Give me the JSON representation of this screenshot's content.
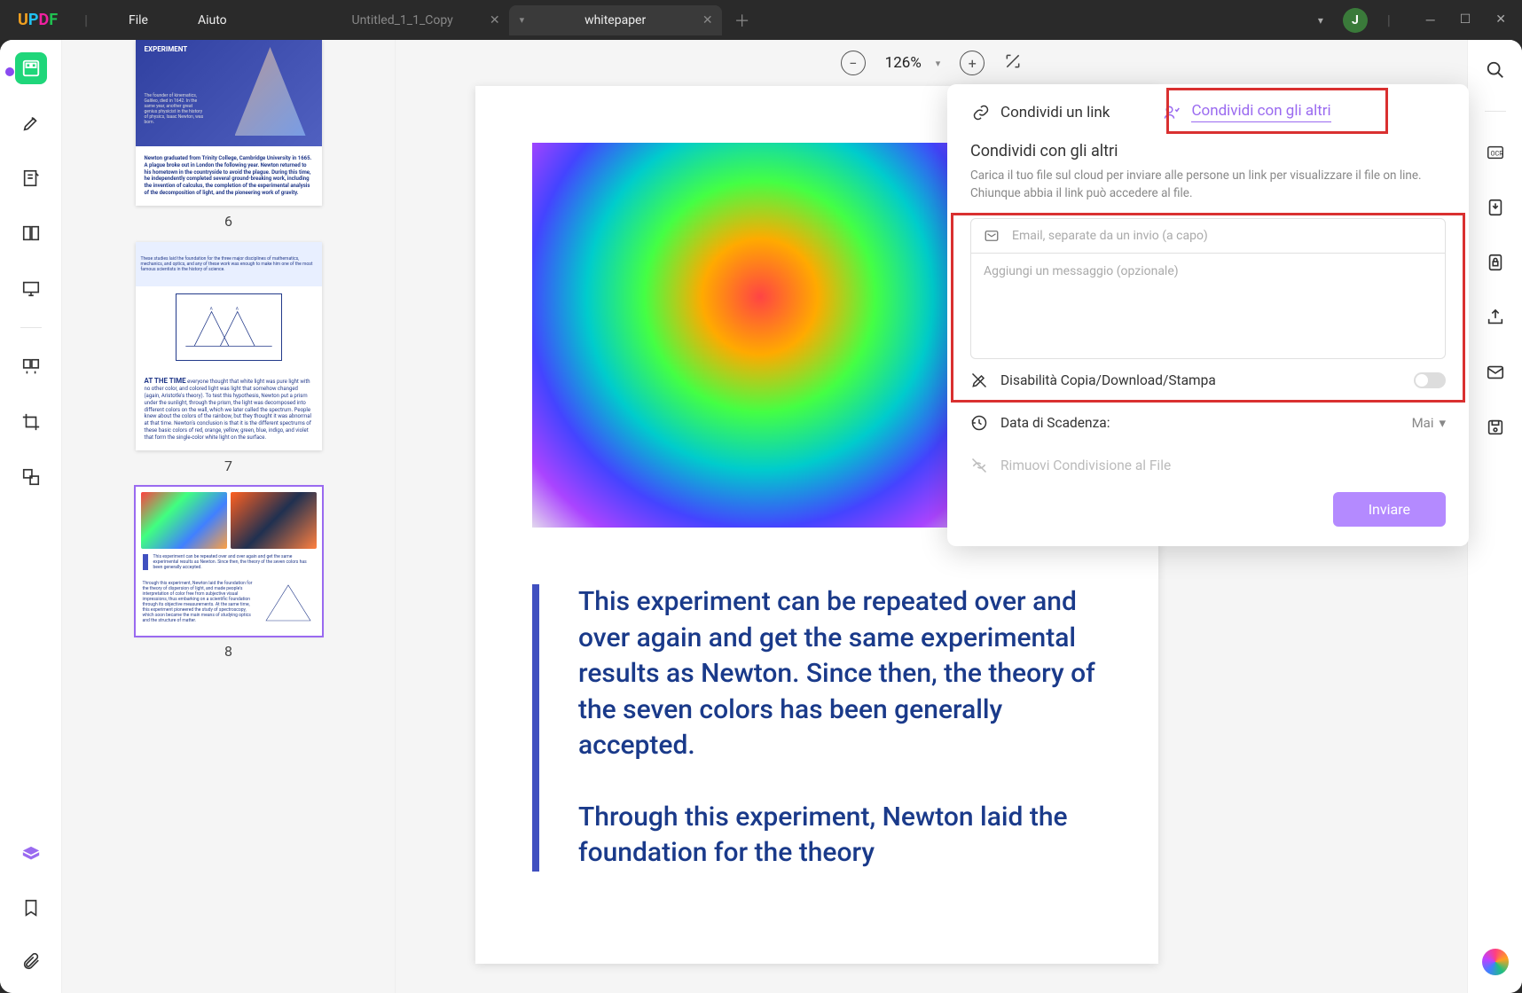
{
  "app": {
    "name": "UPDF"
  },
  "menu": {
    "file": "File",
    "help": "Aiuto"
  },
  "tabs": [
    {
      "title": "Untitled_1_1_Copy",
      "active": false
    },
    {
      "title": "whitepaper",
      "active": true
    }
  ],
  "user": {
    "initial": "J"
  },
  "zoom": {
    "value": "126%"
  },
  "thumbnails": {
    "p6": {
      "num": "6",
      "heroTitle": "EXPERIMENT",
      "body": "Newton graduated from Trinity College, Cambridge University in 1665. A plague broke out in London the following year. Newton returned to his hometown in the countryside to avoid the plague. During this time, he independently completed several ground-breaking work, including the invention of calculus, the completion of the experimental analysis of the decomposition of light, and the pioneering work of gravity."
    },
    "p7": {
      "num": "7",
      "band": "These studies laid the foundation for the three major disciplines of mathematics, mechanics, and optics, and any of these work was enough to make him one of the most famous scientists in the history of science.",
      "heading": "AT THE TIME",
      "body": "everyone thought that white light was pure light with no other color, and colored light was light that somehow changed (again, Aristotle's theory). To test this hypothesis, Newton put a prism under the sunlight, through the prism, the light was decomposed into different colors on the wall, which we later called the spectrum. People knew about the colors of the rainbow, but they thought it was abnormal at that time. Newton's conclusion is that it is the different spectrums of these basic colors of red, orange, yellow, green, blue, indigo, and violet that form the single-color white light on the surface."
    },
    "p8": {
      "num": "8",
      "col1": "This experiment can be repeated over and over again and get the same experimental results as Newton. Since then, the theory of the seven colors has been generally accepted.",
      "col2": "Through this experiment, Newton laid the foundation for the theory of dispersion of light, and made people's interpretation of color free from subjective visual impressions, thus embarking on a scientific foundation through its objective measurements. At the same time, this experiment pioneered the study of spectroscopy, which soon became the main means of studying optics and the structure of matter."
    }
  },
  "document": {
    "para1": "This experiment can be repeated over and over again and get the same experimental results as Newton. Since then, the theory of the seven colors has been generally accepted.",
    "para2": "Through this experiment, Newton laid the foundation for the theory"
  },
  "share": {
    "tab_link": "Condividi un link",
    "tab_others": "Condividi con gli altri",
    "heading": "Condividi con gli altri",
    "desc": "Carica il tuo file sul cloud per inviare alle persone un link per visualizzare il file on line. Chiunque abbia il link può accedere al file.",
    "email_placeholder": "Email, separate da un invio (a capo)",
    "message_placeholder": "Aggiungi un messaggio (opzionale)",
    "opt_disable": "Disabilità Copia/Download/Stampa",
    "opt_expiry": "Data di Scadenza:",
    "expiry_value": "Mai",
    "opt_remove": "Rimuovi Condivisione al File",
    "send": "Inviare"
  }
}
